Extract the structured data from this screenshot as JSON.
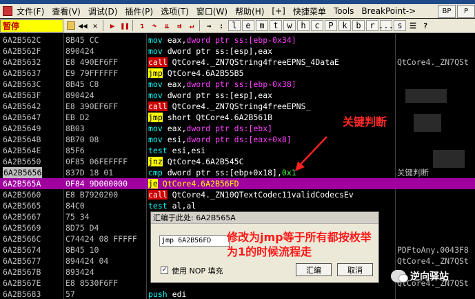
{
  "menu": {
    "items": [
      "文件(F)",
      "查看(V)",
      "调试(D)",
      "插件(P)",
      "选项(T)",
      "窗口(W)",
      "帮助(H)",
      "[+]",
      "快捷菜单",
      "Tools",
      "BreakPoint->"
    ],
    "right_buttons": [
      "BP",
      "P"
    ]
  },
  "toolbar": {
    "status": "暂停",
    "letters": [
      "l",
      "e",
      "m",
      "t",
      "w",
      "h",
      "c",
      "P",
      "k",
      "b",
      "r",
      "...",
      "s"
    ]
  },
  "rows": [
    {
      "addr": "6A2B562C",
      "hex": "8B45 CC",
      "mn": "mov",
      "ops": [
        [
          "op",
          "eax,"
        ],
        [
          "op-s",
          "dword ptr ss:[ebp-0x34]"
        ]
      ],
      "cmt": ""
    },
    {
      "addr": "6A2B562F",
      "hex": "890424",
      "mn": "mov",
      "ops": [
        [
          "op",
          "dword ptr ss:[esp],eax"
        ]
      ],
      "cmt": ""
    },
    {
      "addr": "6A2B5632",
      "hex": "E8 490EF6FF",
      "mn": "call",
      "ops": [
        [
          "op",
          "QtCore4._ZN7QString4freeEPNS_4DataE"
        ]
      ],
      "cmt": "QtCore4._ZN7QSt"
    },
    {
      "addr": "6A2B5637",
      "hex": "E9 79FFFFFF",
      "mn": "jmp",
      "ops": [
        [
          "op",
          "QtCore4.6A2B55B5"
        ]
      ],
      "cmt": ""
    },
    {
      "addr": "6A2B563C",
      "hex": "8B45 C8",
      "mn": "mov",
      "ops": [
        [
          "op",
          "eax,"
        ],
        [
          "op-s",
          "dword ptr ss:[ebp-0x38]"
        ]
      ],
      "cmt": ""
    },
    {
      "addr": "6A2B563F",
      "hex": "890424",
      "mn": "mov",
      "ops": [
        [
          "op",
          "dword ptr ss:[esp],eax"
        ]
      ],
      "cmt": ""
    },
    {
      "addr": "6A2B5642",
      "hex": "E8 390EF6FF",
      "mn": "call",
      "ops": [
        [
          "op",
          "QtCore4._ZN7QString4freeEPNS_"
        ]
      ],
      "cmt": ""
    },
    {
      "addr": "6A2B5647",
      "hex": "EB D2",
      "mn": "jmp",
      "ops": [
        [
          "op",
          "short QtCore4.6A2B561B"
        ]
      ],
      "cmt": ""
    },
    {
      "addr": "6A2B5649",
      "hex": "8B03",
      "mn": "mov",
      "ops": [
        [
          "op",
          "eax,"
        ],
        [
          "op-s",
          "dword ptr ds:[ebx]"
        ]
      ],
      "cmt": ""
    },
    {
      "addr": "6A2B564B",
      "hex": "8B70 08",
      "mn": "mov",
      "ops": [
        [
          "op",
          "esi,"
        ],
        [
          "op-s",
          "dword ptr ds:[eax+0x8]"
        ]
      ],
      "cmt": ""
    },
    {
      "addr": "6A2B564E",
      "hex": "85F6",
      "mn": "test",
      "ops": [
        [
          "op",
          "esi,esi"
        ]
      ],
      "cmt": ""
    },
    {
      "addr": "6A2B5650",
      "hex": "0F85 06FEFFFF",
      "mn": "jnz",
      "ops": [
        [
          "op",
          "QtCore4.6A2B545C"
        ]
      ],
      "cmt": ""
    },
    {
      "addr": "6A2B5656",
      "hex": "837D 18 01",
      "mn": "cmp",
      "ops": [
        [
          "op",
          "dword ptr ss:[ebp+0x18],"
        ],
        [
          "op-n",
          "0x1"
        ]
      ],
      "cmt": "关键判断"
    },
    {
      "addr": "6A2B565A",
      "hex": "0F84 9D000000",
      "mn": "je",
      "ops": [
        [
          "op",
          "QtCore4.6A2B56FD"
        ]
      ],
      "cmt": ""
    },
    {
      "addr": "6A2B5660",
      "hex": "E8 B7920200",
      "mn": "call",
      "ops": [
        [
          "op",
          "QtCore4._ZN10QTextCodec11validCodecsEv"
        ]
      ],
      "cmt": ""
    },
    {
      "addr": "6A2B5665",
      "hex": "84C0",
      "mn": "test",
      "ops": [
        [
          "op",
          "al,al"
        ]
      ],
      "cmt": ""
    },
    {
      "addr": "6A2B5667",
      "hex": "75 34",
      "mn": "",
      "ops": [],
      "cmt": ""
    },
    {
      "addr": "6A2B5669",
      "hex": "8D75 D4",
      "mn": "",
      "ops": [],
      "cmt": ""
    },
    {
      "addr": "6A2B566C",
      "hex": "C74424 08 FFFFF",
      "mn": "",
      "ops": [],
      "cmt": ""
    },
    {
      "addr": "6A2B5674",
      "hex": "8B45 10",
      "mn": "",
      "ops": [],
      "cmt": "PDFtoAny.0043F8"
    },
    {
      "addr": "6A2B5677",
      "hex": "894424 04",
      "mn": "",
      "ops": [],
      "cmt": "QtCore4._ZN7QSt"
    },
    {
      "addr": "6A2B567B",
      "hex": "893424",
      "mn": "",
      "ops": [],
      "cmt": ""
    },
    {
      "addr": "6A2B567E",
      "hex": "E8 8530F6FF",
      "mn": "",
      "ops": [],
      "cmt": "QtCore4._ZN7QSt"
    },
    {
      "addr": "6A2B5683",
      "hex": "57",
      "mn": "push",
      "ops": [
        [
          "op",
          "edi"
        ]
      ],
      "cmt": ""
    }
  ],
  "annotation": {
    "label": "关键判断"
  },
  "dialog": {
    "title": "汇编于此处: 6A2B565A",
    "input_value": "jmp 6A2B56FD",
    "checkbox_label": "使用 NOP 填充",
    "ok_label": "汇编",
    "cancel_label": "取消",
    "note": "修改为jmp等于所有都按枚举为1的时候流程走"
  },
  "watermark": {
    "text": "逆向驿站"
  }
}
